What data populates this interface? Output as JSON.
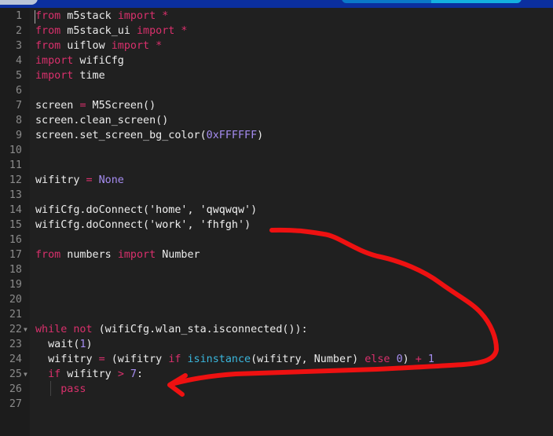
{
  "colors": {
    "keyword": "#d9306c",
    "number": "#a58cf0",
    "builtin": "#3ab6dc",
    "text": "#ececec",
    "annotation": "#ee1111",
    "background": "#202020",
    "topbar": "#0b2f9e"
  },
  "lines": [
    {
      "n": "1",
      "t": [
        [
          "kw",
          "from"
        ],
        [
          "",
          "  m5stack "
        ],
        [
          "kw",
          "import *"
        ]
      ]
    },
    {
      "n": "2",
      "t": [
        [
          "kw",
          "from"
        ],
        [
          "",
          "  m5stack_ui "
        ],
        [
          "kw",
          "import *"
        ]
      ]
    },
    {
      "n": "3",
      "t": [
        [
          "kw",
          "from"
        ],
        [
          "",
          "  uiflow "
        ],
        [
          "kw",
          "import *"
        ]
      ]
    },
    {
      "n": "4",
      "t": [
        [
          "kw",
          "import"
        ],
        [
          "",
          "",
          " wificfg"
        ]
      ]
    },
    {
      "n": "5",
      "t": [
        [
          "kw",
          "import"
        ],
        [
          "",
          " time"
        ]
      ]
    },
    {
      "n": "6",
      "t": []
    },
    {
      "n": "7",
      "t": [
        [
          "",
          "screen "
        ],
        [
          "kw",
          "="
        ],
        [
          "",
          " M5Screen()"
        ]
      ]
    },
    {
      "n": "8",
      "t": [
        [
          "",
          "screen.clean_screen()"
        ]
      ]
    },
    {
      "n": "9",
      "t": [
        [
          "",
          "screen.set_screen_bg_color("
        ],
        [
          "num",
          "0xFFFFFF"
        ],
        [
          "",
          ")"
        ]
      ]
    },
    {
      "n": "10",
      "t": []
    },
    {
      "n": "11",
      "t": []
    },
    {
      "n": "12",
      "t": [
        [
          "",
          "wifitry "
        ],
        [
          "kw",
          "="
        ],
        [
          "num",
          " None"
        ]
      ]
    },
    {
      "n": "13",
      "t": []
    },
    {
      "n": "14",
      "t": [
        [
          "",
          "wifiCfg.doConnect("
        ],
        [
          "str",
          "'home'"
        ],
        [
          "",
          ", "
        ],
        [
          "str",
          "'qwqwqw'"
        ],
        [
          "",
          ")"
        ]
      ]
    },
    {
      "n": "15",
      "t": [
        [
          "",
          "wifiCfg.doConnect("
        ],
        [
          "str",
          "'work'"
        ],
        [
          "",
          ", "
        ],
        [
          "str",
          "'fhfgh'"
        ],
        [
          "",
          ")"
        ]
      ]
    },
    {
      "n": "16",
      "t": []
    },
    {
      "n": "17",
      "t": [
        [
          "kw",
          "from"
        ],
        [
          "",
          " numbers "
        ],
        [
          "kw",
          "import"
        ],
        [
          "",
          " Number"
        ]
      ]
    },
    {
      "n": "18",
      "t": []
    },
    {
      "n": "19",
      "t": []
    },
    {
      "n": "20",
      "t": []
    },
    {
      "n": "21",
      "t": []
    },
    {
      "n": "22",
      "fold": true,
      "t": [
        [
          "kw",
          "while not"
        ],
        [
          "",
          " (wifiCfg.wlan_sta.isconnected()):"
        ]
      ]
    },
    {
      "n": "23",
      "t": [
        [
          "",
          "  wait("
        ],
        [
          "num",
          "1"
        ],
        [
          "",
          ")"
        ]
      ]
    },
    {
      "n": "24",
      "t": [
        [
          "",
          "  wifitry "
        ],
        [
          "kw",
          "="
        ],
        [
          "",
          " (wifitry "
        ],
        [
          "kw",
          "if"
        ],
        [
          "",
          " "
        ],
        [
          "bi",
          "isinstance"
        ],
        [
          "",
          "(wifitry, Number) "
        ],
        [
          "kw",
          "else"
        ],
        [
          "",
          " "
        ],
        [
          "num",
          "0"
        ],
        [
          "",
          ") "
        ],
        [
          "kw",
          "+"
        ],
        [
          "num",
          " 1"
        ]
      ]
    },
    {
      "n": "25",
      "fold": true,
      "t": [
        [
          "",
          "  "
        ],
        [
          "kw",
          "if"
        ],
        [
          "",
          " wifitry "
        ],
        [
          "kw",
          ">"
        ],
        [
          "num",
          " 7"
        ],
        [
          "",
          ":"
        ]
      ]
    },
    {
      "n": "26",
      "t": [
        [
          "",
          "    "
        ],
        [
          "kw",
          "pass"
        ]
      ]
    },
    {
      "n": "27",
      "t": []
    }
  ]
}
